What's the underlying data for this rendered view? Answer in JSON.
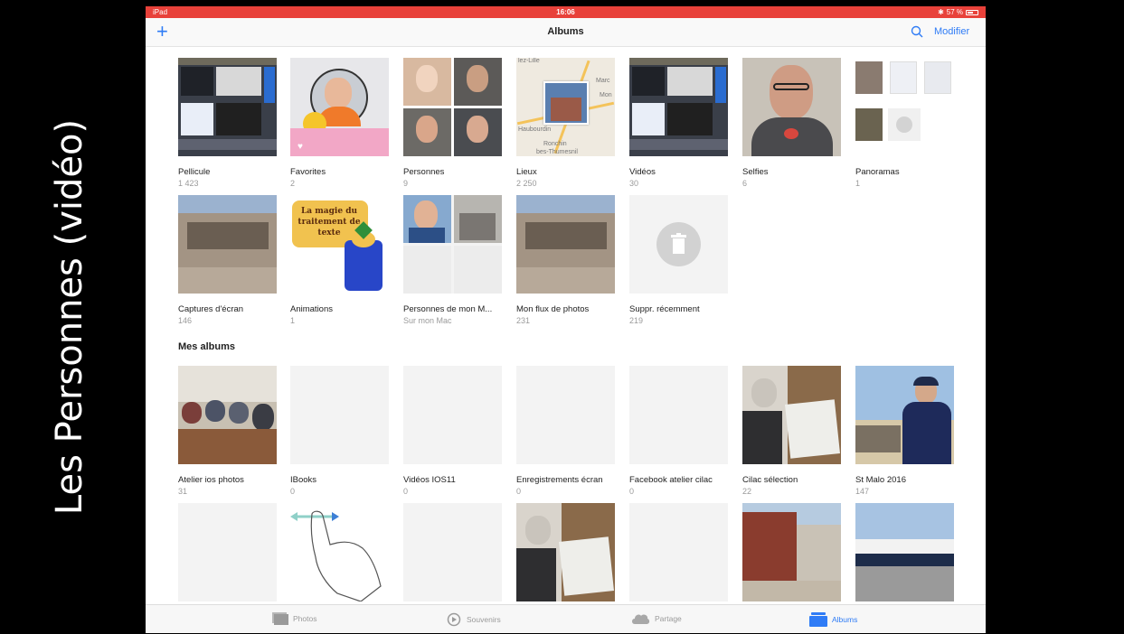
{
  "side_title": "Les Personnes  (vidéo)",
  "status": {
    "left": "iPad",
    "time": "16:06",
    "battery": "57 %"
  },
  "nav": {
    "add": "+",
    "title": "Albums",
    "edit": "Modifier"
  },
  "albums": [
    {
      "name": "Pellicule",
      "count": "1 423"
    },
    {
      "name": "Favorites",
      "count": "2"
    },
    {
      "name": "Personnes",
      "count": "9"
    },
    {
      "name": "Lieux",
      "count": "2 250"
    },
    {
      "name": "Vidéos",
      "count": "30"
    },
    {
      "name": "Selfies",
      "count": "6"
    },
    {
      "name": "Panoramas",
      "count": "1"
    },
    {
      "name": "Captures d'écran",
      "count": "146"
    },
    {
      "name": "Animations",
      "count": "1"
    },
    {
      "name": "Personnes de mon M...",
      "count": "Sur mon Mac"
    },
    {
      "name": "Mon flux de photos",
      "count": "231"
    },
    {
      "name": "Suppr. récemment",
      "count": "219"
    }
  ],
  "thumb_text": {
    "animation": "La magie du traitement de texte",
    "map_labels": [
      "lez-Lille",
      "Marc",
      "Mon",
      "Haubourdin",
      "Ronchin",
      "bes-Thumesnil"
    ]
  },
  "my_albums_title": "Mes albums",
  "my_albums": [
    {
      "name": "Atelier ios photos",
      "count": "31"
    },
    {
      "name": "IBooks",
      "count": "0"
    },
    {
      "name": "Vidéos IOS11",
      "count": "0"
    },
    {
      "name": "Enregistrements écran",
      "count": "0"
    },
    {
      "name": "Facebook atelier cilac",
      "count": "0"
    },
    {
      "name": "Cilac sélection",
      "count": "22"
    },
    {
      "name": "St Malo 2016",
      "count": "147"
    }
  ],
  "tabs": [
    {
      "label": "Photos",
      "icon": "photos-icon"
    },
    {
      "label": "Souvenirs",
      "icon": "memories-icon"
    },
    {
      "label": "Partage",
      "icon": "cloud-icon"
    },
    {
      "label": "Albums",
      "icon": "albums-icon"
    }
  ],
  "colors": {
    "accent": "#2f7cf6",
    "status_bar": "#e8413a"
  }
}
